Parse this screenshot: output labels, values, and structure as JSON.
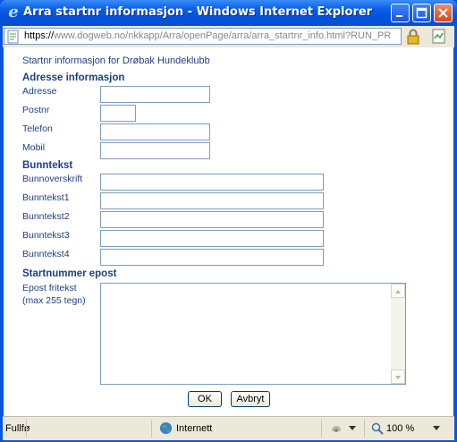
{
  "window": {
    "title": "Arra startnr informasjon - Windows Internet Explorer",
    "title_icon": "ie-icon",
    "brand_color": "#0a55e0"
  },
  "address_bar": {
    "url_prefix": "https://",
    "url_domain": "www.dogweb.no",
    "url_path": "/nkkapp/Arra/openPage/arra/arra_startnr_info.html?RUN_PR"
  },
  "form": {
    "heading": "Startnr informasjon for Drøbak Hundeklubb",
    "adresse_section": "Adresse informasjon",
    "fields_adresse": [
      {
        "label": "Adresse",
        "value": ""
      },
      {
        "label": "Postnr",
        "value": ""
      },
      {
        "label": "Telefon",
        "value": ""
      },
      {
        "label": "Mobil",
        "value": ""
      }
    ],
    "bunntekst_section": "Bunntekst",
    "fields_bunntekst": [
      {
        "label": "Bunnoverskrift",
        "value": ""
      },
      {
        "label": "Bunntekst1",
        "value": ""
      },
      {
        "label": "Bunntekst2",
        "value": ""
      },
      {
        "label": "Bunntekst3",
        "value": ""
      },
      {
        "label": "Bunntekst4",
        "value": ""
      }
    ],
    "epost_section": "Startnummer epost",
    "epost_label_1": "Epost fritekst",
    "epost_label_2": "(max 255 tegn)",
    "epost_value": "",
    "ok_label": "OK",
    "cancel_label": "Avbryt"
  },
  "status_bar": {
    "status_text": "Fullfø",
    "zone": "Internett",
    "zoom": "100 %"
  }
}
